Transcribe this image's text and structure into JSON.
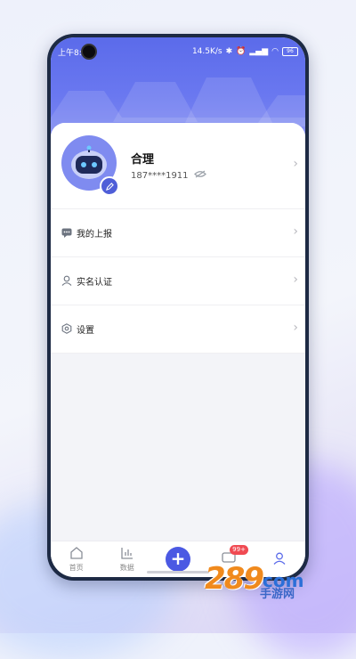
{
  "status": {
    "time": "上午8:56",
    "net_speed": "14.5K/s",
    "battery": "96"
  },
  "profile": {
    "name": "合理",
    "phone": "187****1911"
  },
  "menu": [
    {
      "label": "我的上报",
      "icon": "message-icon"
    },
    {
      "label": "实名认证",
      "icon": "user-icon"
    },
    {
      "label": "设置",
      "icon": "settings-icon"
    }
  ],
  "tabs": [
    {
      "label": "首页",
      "icon": "home-icon"
    },
    {
      "label": "数据",
      "icon": "chart-icon"
    },
    {
      "label": "",
      "icon": "plus-icon"
    },
    {
      "label": "",
      "icon": "message-icon",
      "badge": "99+"
    },
    {
      "label": "",
      "icon": "profile-icon"
    }
  ],
  "watermark": {
    "number": "289",
    "domain": "com",
    "text": "手游网"
  },
  "colors": {
    "accent": "#4b59e3",
    "header": "#5b6bea",
    "badge": "#f04a52"
  }
}
